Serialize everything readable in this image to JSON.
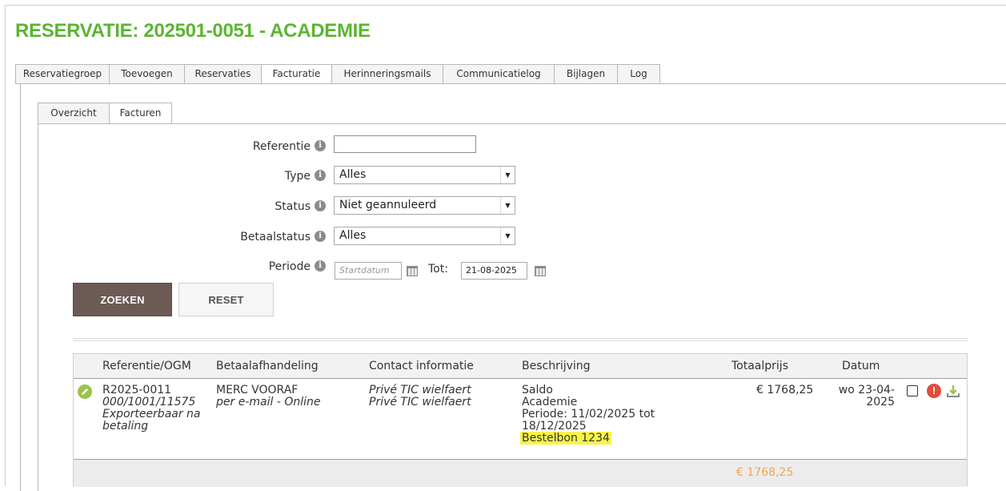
{
  "page": {
    "title": "RESERVATIE: 202501-0051 - ACADEMIE",
    "colors": {
      "title": "#5cb531",
      "search_button": "#6c5b55",
      "highlight": "#f9f348",
      "total_price": "#f0a55b",
      "edit_icon": "#9cc34a",
      "warning_icon": "#e34b3c"
    }
  },
  "tabs": [
    {
      "label": "Reservatiegroep",
      "active": false
    },
    {
      "label": "Toevoegen",
      "active": false
    },
    {
      "label": "Reservaties",
      "active": false
    },
    {
      "label": "Facturatie",
      "active": true
    },
    {
      "label": "Herinneringsmails",
      "active": false
    },
    {
      "label": "Communicatielog",
      "active": false
    },
    {
      "label": "Bijlagen",
      "active": false
    },
    {
      "label": "Log",
      "active": false
    }
  ],
  "subtabs": [
    {
      "label": "Overzicht",
      "active": false
    },
    {
      "label": "Facturen",
      "active": true
    }
  ],
  "filters": {
    "info_icon": "info-icon",
    "referentie": {
      "label": "Referentie",
      "value": ""
    },
    "type": {
      "label": "Type",
      "value": "Alles"
    },
    "status": {
      "label": "Status",
      "value": "Niet geannuleerd"
    },
    "betaalstatus": {
      "label": "Betaalstatus",
      "value": "Alles"
    },
    "periode": {
      "label": "Periode",
      "start_placeholder": "Startdatum",
      "tot_label": "Tot:",
      "end_value": "21-08-2025"
    }
  },
  "buttons": {
    "search": "ZOEKEN",
    "reset": "RESET"
  },
  "table": {
    "headers": {
      "referentie": "Referentie/OGM",
      "betaal": "Betaalafhandeling",
      "contact": "Contact informatie",
      "beschrijving": "Beschrijving",
      "totaalprijs": "Totaalprijs",
      "datum": "Datum"
    },
    "rows": [
      {
        "referentie": "R2025-0011",
        "ogm": "000/1001/11575",
        "export_line1": "Exporteerbaar na",
        "export_line2": "betaling",
        "betaal_method": "MERC VOORAF",
        "betaal_detail": "per e-mail - Online",
        "contact1": "Privé TIC wielfaert",
        "contact2": "Privé TIC wielfaert",
        "desc1": "Saldo",
        "desc2": "Academie",
        "desc3": "Periode: 11/02/2025 tot",
        "desc4": "18/12/2025",
        "desc5": "Bestelbon 1234",
        "prijs": "€ 1768,25",
        "datum1": "wo 23-04-",
        "datum2": "2025",
        "icons": [
          "edit-icon",
          "checkbox",
          "warning-icon",
          "download-icon"
        ]
      }
    ],
    "total": "€ 1768,25"
  }
}
